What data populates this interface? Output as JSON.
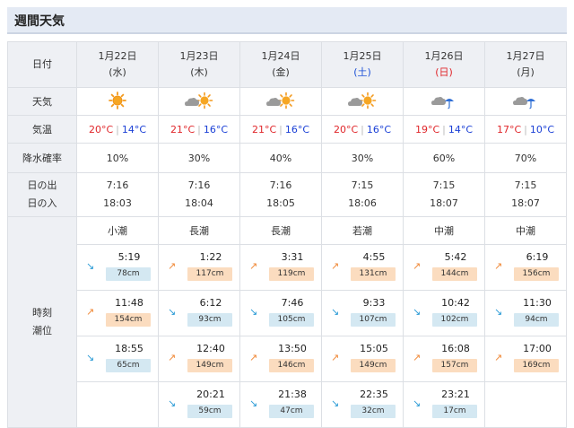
{
  "title": "週間天気",
  "labels": {
    "date": "日付",
    "weather": "天気",
    "temp": "気温",
    "rain": "降水確率",
    "sunrise": "日の出",
    "sunset": "日の入",
    "tide_time": "時刻",
    "tide_level": "潮位"
  },
  "days": [
    {
      "date": "1月22日",
      "dow": "(水)",
      "dow_type": "weekday",
      "weather": "sunny",
      "high": "20°C",
      "low": "14°C",
      "rain": "10%",
      "sunrise": "7:16",
      "sunset": "18:03",
      "tide_name": "小潮",
      "tides": [
        {
          "time": "5:19",
          "cm": "78cm",
          "dir": "down"
        },
        {
          "time": "11:48",
          "cm": "154cm",
          "dir": "up"
        },
        {
          "time": "18:55",
          "cm": "65cm",
          "dir": "down"
        }
      ]
    },
    {
      "date": "1月23日",
      "dow": "(木)",
      "dow_type": "weekday",
      "weather": "cloudy-sunny",
      "high": "21°C",
      "low": "16°C",
      "rain": "30%",
      "sunrise": "7:16",
      "sunset": "18:04",
      "tide_name": "長潮",
      "tides": [
        {
          "time": "1:22",
          "cm": "117cm",
          "dir": "up"
        },
        {
          "time": "6:12",
          "cm": "93cm",
          "dir": "down"
        },
        {
          "time": "12:40",
          "cm": "149cm",
          "dir": "up"
        },
        {
          "time": "20:21",
          "cm": "59cm",
          "dir": "down"
        }
      ]
    },
    {
      "date": "1月24日",
      "dow": "(金)",
      "dow_type": "weekday",
      "weather": "cloudy-sunny",
      "high": "21°C",
      "low": "16°C",
      "rain": "40%",
      "sunrise": "7:16",
      "sunset": "18:05",
      "tide_name": "長潮",
      "tides": [
        {
          "time": "3:31",
          "cm": "119cm",
          "dir": "up"
        },
        {
          "time": "7:46",
          "cm": "105cm",
          "dir": "down"
        },
        {
          "time": "13:50",
          "cm": "146cm",
          "dir": "up"
        },
        {
          "time": "21:38",
          "cm": "47cm",
          "dir": "down"
        }
      ]
    },
    {
      "date": "1月25日",
      "dow": "(土)",
      "dow_type": "sat",
      "weather": "cloudy-sunny",
      "high": "20°C",
      "low": "16°C",
      "rain": "30%",
      "sunrise": "7:15",
      "sunset": "18:06",
      "tide_name": "若潮",
      "tides": [
        {
          "time": "4:55",
          "cm": "131cm",
          "dir": "up"
        },
        {
          "time": "9:33",
          "cm": "107cm",
          "dir": "down"
        },
        {
          "time": "15:05",
          "cm": "149cm",
          "dir": "up"
        },
        {
          "time": "22:35",
          "cm": "32cm",
          "dir": "down"
        }
      ]
    },
    {
      "date": "1月26日",
      "dow": "(日)",
      "dow_type": "sun",
      "weather": "cloudy-rain",
      "high": "19°C",
      "low": "14°C",
      "rain": "60%",
      "sunrise": "7:15",
      "sunset": "18:07",
      "tide_name": "中潮",
      "tides": [
        {
          "time": "5:42",
          "cm": "144cm",
          "dir": "up"
        },
        {
          "time": "10:42",
          "cm": "102cm",
          "dir": "down"
        },
        {
          "time": "16:08",
          "cm": "157cm",
          "dir": "up"
        },
        {
          "time": "23:21",
          "cm": "17cm",
          "dir": "down"
        }
      ]
    },
    {
      "date": "1月27日",
      "dow": "(月)",
      "dow_type": "weekday",
      "weather": "cloudy-rain",
      "high": "17°C",
      "low": "10°C",
      "rain": "70%",
      "sunrise": "7:15",
      "sunset": "18:07",
      "tide_name": "中潮",
      "tides": [
        {
          "time": "6:19",
          "cm": "156cm",
          "dir": "up"
        },
        {
          "time": "11:30",
          "cm": "94cm",
          "dir": "down"
        },
        {
          "time": "17:00",
          "cm": "169cm",
          "dir": "up"
        }
      ]
    }
  ],
  "colors": {
    "high": "#e0262a",
    "low": "#1a3fd6",
    "tide_high_bg": "#fbdcbf",
    "tide_low_bg": "#d4e8f2",
    "header_bg": "#e4eaf4"
  }
}
